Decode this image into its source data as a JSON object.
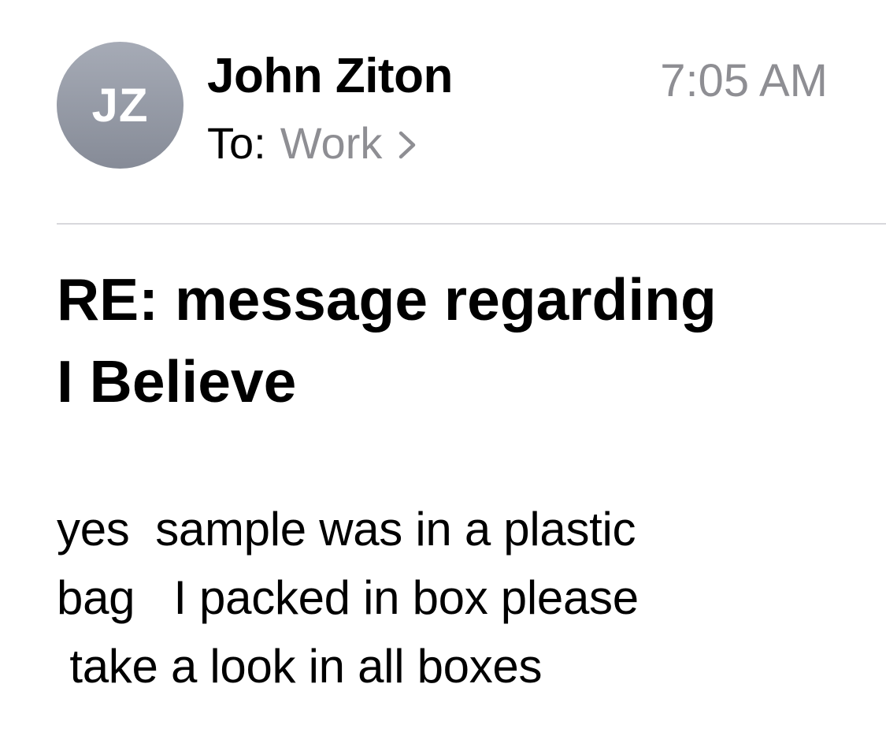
{
  "header": {
    "avatar_initials": "JZ",
    "sender_name": "John Ziton",
    "time": "7:05 AM",
    "to_label": "To:",
    "to_value": "Work",
    "chevron_icon": "chevron-right-icon"
  },
  "email": {
    "subject_lines": [
      "RE: message regarding",
      "I Believe"
    ],
    "body_lines": [
      "yes  sample was in a plastic",
      "bag   I packed in box please",
      " take a look in all boxes"
    ]
  },
  "colors": {
    "secondary_text": "#8e8e93",
    "avatar_bg": "#979ca7",
    "divider": "#d8d8dc"
  }
}
